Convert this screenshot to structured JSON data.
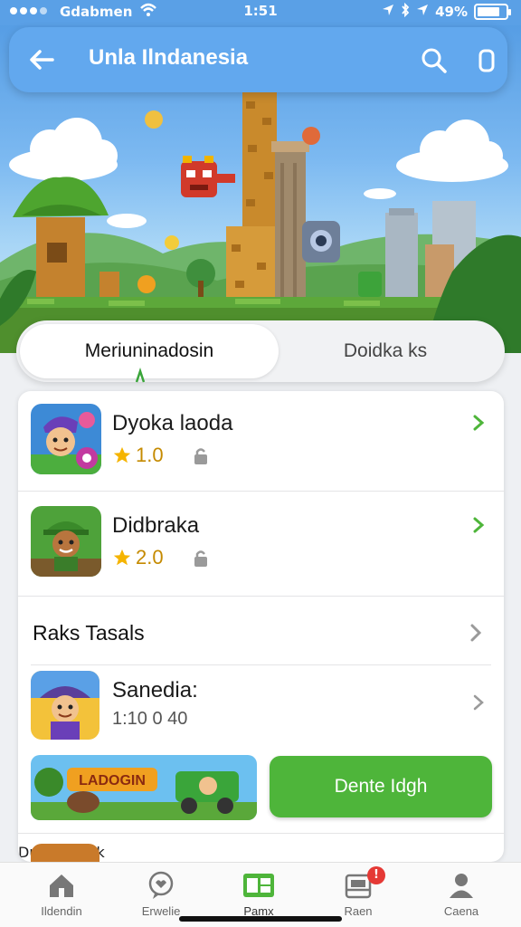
{
  "status_bar": {
    "carrier": "Gdabmen",
    "time": "1:51",
    "battery": "49%"
  },
  "app_bar": {
    "title": "Unla Ilndanesia"
  },
  "tabs": [
    {
      "label": "Meriuninadosin",
      "active": true
    },
    {
      "label": "Doidka ks",
      "active": false
    }
  ],
  "games": [
    {
      "name": "Dyoka laoda",
      "rating": "1.0"
    },
    {
      "name": "Didbraka",
      "rating": "2.0"
    }
  ],
  "section": {
    "title": "Raks Tasals",
    "item": {
      "name": "Sanedia:",
      "meta": "1:10 0 40"
    }
  },
  "promo": {
    "banner_text": "LADOGIN",
    "button_label": "Dente Idgh"
  },
  "peek_item": {
    "name": "Dudeal Iadk"
  },
  "bottom_nav": [
    {
      "label": "Ildendin",
      "icon": "home-icon"
    },
    {
      "label": "Erwelie",
      "icon": "heart-chat-icon"
    },
    {
      "label": "Pamx",
      "icon": "games-icon",
      "active": true
    },
    {
      "label": "Raen",
      "icon": "inbox-icon",
      "badge": "!"
    },
    {
      "label": "Caena",
      "icon": "profile-icon"
    }
  ],
  "colors": {
    "app_bar": "#62a8ee",
    "accent_green": "#4eb53a",
    "badge_red": "#e53935",
    "star": "#f5b400"
  }
}
